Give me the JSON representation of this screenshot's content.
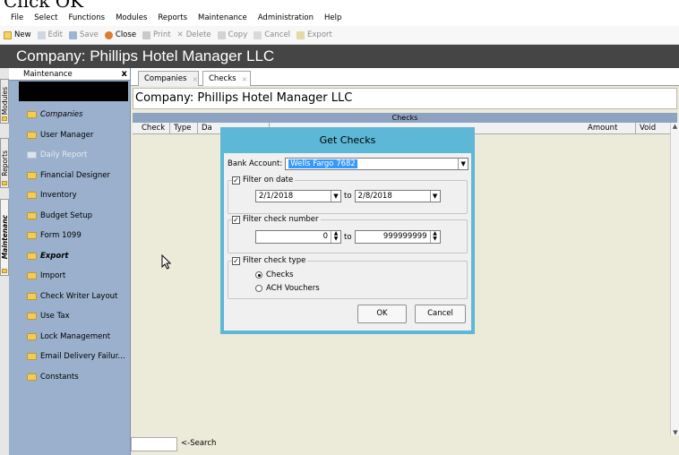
{
  "caption": "Click OK",
  "menu": [
    "File",
    "Select",
    "Functions",
    "Modules",
    "Reports",
    "Maintenance",
    "Administration",
    "Help"
  ],
  "toolbar": {
    "new": "New",
    "edit": "Edit",
    "save": "Save",
    "close": "Close",
    "print": "Print",
    "delete": "Delete",
    "copy": "Copy",
    "cancel": "Cancel",
    "export": "Export"
  },
  "company_bar": "Company:  Phillips Hotel Manager LLC",
  "vtabs": {
    "modules": "Modules",
    "reports": "Reports",
    "maintenance": "Maintenanc"
  },
  "sidebar": {
    "title": "Maintenance",
    "close": "x",
    "items": [
      {
        "label": "Companies"
      },
      {
        "label": "User Manager"
      },
      {
        "label": "Daily Report"
      },
      {
        "label": "Financial Designer"
      },
      {
        "label": "Inventory"
      },
      {
        "label": "Budget Setup"
      },
      {
        "label": "Form 1099"
      },
      {
        "label": "Export"
      },
      {
        "label": "Import"
      },
      {
        "label": "Check Writer Layout"
      },
      {
        "label": "Use Tax"
      },
      {
        "label": "Lock Management"
      },
      {
        "label": "Email Delivery Failur..."
      },
      {
        "label": "Constants"
      }
    ]
  },
  "tabs": {
    "companies": "Companies",
    "checks": "Checks",
    "close": "×"
  },
  "content": {
    "title": "Company:  Phillips Hotel Manager LLC",
    "grid_title": "Checks",
    "columns": {
      "check": "Check",
      "type": "Type",
      "date": "Da",
      "amount": "Amount",
      "void": "Void"
    },
    "search_label": "<-Search"
  },
  "dialog": {
    "title": "Get Checks",
    "bank_label": "Bank Account:",
    "bank_value": "Wells Fargo 7682",
    "filter_date_label": "Filter on date",
    "date_from": "2/1/2018",
    "to1": "to",
    "date_to": "2/8/2018",
    "filter_check_label": "Filter check number",
    "check_from": "0",
    "to2": "to",
    "check_to": "999999999",
    "filter_type_label": "Filter check type",
    "radio_checks": "Checks",
    "radio_ach": "ACH Vouchers",
    "ok": "OK",
    "cancel": "Cancel"
  },
  "colors": {
    "sidebar": "#9ab0cc",
    "company_bar": "#454545",
    "dialog_frame": "#5db7d6",
    "content": "#ecead8"
  }
}
